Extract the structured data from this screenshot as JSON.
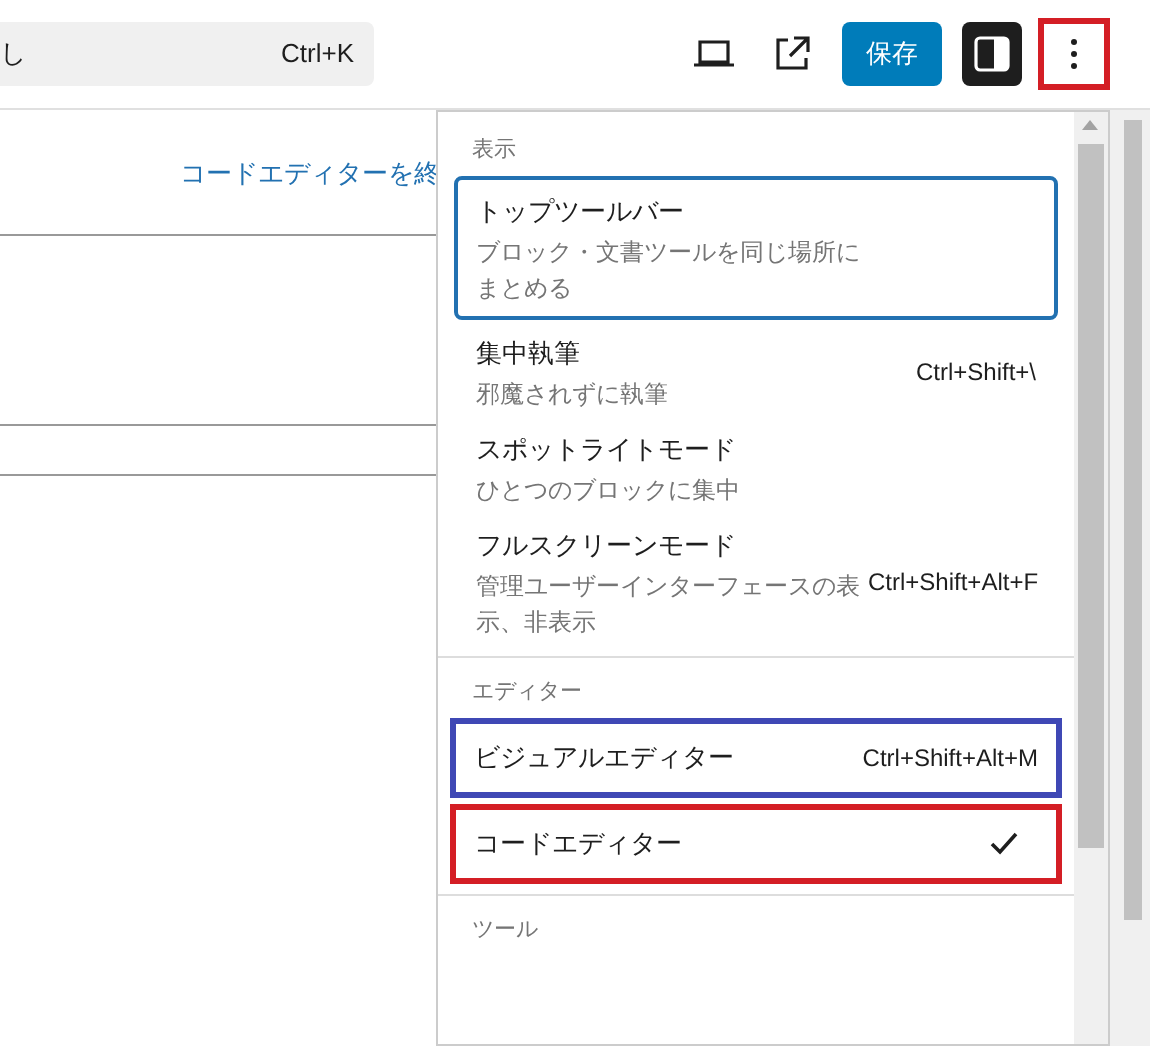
{
  "toolbar": {
    "search": {
      "value": "し",
      "shortcut": "Ctrl+K"
    },
    "save_button": "保存",
    "sidebar_toggle": {
      "on": true
    },
    "more_button": {
      "color": "#d41e25"
    }
  },
  "editor": {
    "exit_link": "コードエディターを終"
  },
  "menu": {
    "groups": [
      {
        "heading": "表示",
        "items": [
          {
            "label": "トップツールバー",
            "description": "ブロック・文書ツールを同じ場所にまとめる",
            "focused": true
          },
          {
            "label": "集中執筆",
            "description": "邪魔されずに執筆",
            "shortcut": "Ctrl+Shift+\\",
            "focused": false
          },
          {
            "label": "スポットライトモード",
            "description": "ひとつのブロックに集中",
            "focused": false
          },
          {
            "label": "フルスクリーンモード",
            "description": "管理ユーザーインターフェースの表示、非表示",
            "shortcut": "Ctrl+Shift+Alt+F",
            "focused": false
          }
        ]
      },
      {
        "heading": "エディター",
        "items": [
          {
            "label": "ビジュアルエディター",
            "shortcut": "Ctrl+Shift+Alt+M",
            "checked": false,
            "color": "#3f48b5"
          },
          {
            "label": "コードエディター",
            "checked": true,
            "color": "#d41e25"
          }
        ]
      },
      {
        "heading": "ツール"
      }
    ]
  }
}
